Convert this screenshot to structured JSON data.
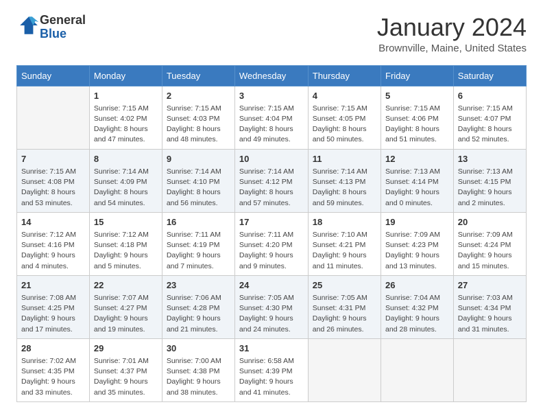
{
  "logo": {
    "text_general": "General",
    "text_blue": "Blue"
  },
  "header": {
    "month_title": "January 2024",
    "location": "Brownville, Maine, United States"
  },
  "weekdays": [
    "Sunday",
    "Monday",
    "Tuesday",
    "Wednesday",
    "Thursday",
    "Friday",
    "Saturday"
  ],
  "weeks": [
    [
      {
        "day": "",
        "empty": true
      },
      {
        "day": "1",
        "sunrise": "7:15 AM",
        "sunset": "4:02 PM",
        "daylight": "8 hours and 47 minutes."
      },
      {
        "day": "2",
        "sunrise": "7:15 AM",
        "sunset": "4:03 PM",
        "daylight": "8 hours and 48 minutes."
      },
      {
        "day": "3",
        "sunrise": "7:15 AM",
        "sunset": "4:04 PM",
        "daylight": "8 hours and 49 minutes."
      },
      {
        "day": "4",
        "sunrise": "7:15 AM",
        "sunset": "4:05 PM",
        "daylight": "8 hours and 50 minutes."
      },
      {
        "day": "5",
        "sunrise": "7:15 AM",
        "sunset": "4:06 PM",
        "daylight": "8 hours and 51 minutes."
      },
      {
        "day": "6",
        "sunrise": "7:15 AM",
        "sunset": "4:07 PM",
        "daylight": "8 hours and 52 minutes."
      }
    ],
    [
      {
        "day": "7",
        "sunrise": "7:15 AM",
        "sunset": "4:08 PM",
        "daylight": "8 hours and 53 minutes."
      },
      {
        "day": "8",
        "sunrise": "7:14 AM",
        "sunset": "4:09 PM",
        "daylight": "8 hours and 54 minutes."
      },
      {
        "day": "9",
        "sunrise": "7:14 AM",
        "sunset": "4:10 PM",
        "daylight": "8 hours and 56 minutes."
      },
      {
        "day": "10",
        "sunrise": "7:14 AM",
        "sunset": "4:12 PM",
        "daylight": "8 hours and 57 minutes."
      },
      {
        "day": "11",
        "sunrise": "7:14 AM",
        "sunset": "4:13 PM",
        "daylight": "8 hours and 59 minutes."
      },
      {
        "day": "12",
        "sunrise": "7:13 AM",
        "sunset": "4:14 PM",
        "daylight": "9 hours and 0 minutes."
      },
      {
        "day": "13",
        "sunrise": "7:13 AM",
        "sunset": "4:15 PM",
        "daylight": "9 hours and 2 minutes."
      }
    ],
    [
      {
        "day": "14",
        "sunrise": "7:12 AM",
        "sunset": "4:16 PM",
        "daylight": "9 hours and 4 minutes."
      },
      {
        "day": "15",
        "sunrise": "7:12 AM",
        "sunset": "4:18 PM",
        "daylight": "9 hours and 5 minutes."
      },
      {
        "day": "16",
        "sunrise": "7:11 AM",
        "sunset": "4:19 PM",
        "daylight": "9 hours and 7 minutes."
      },
      {
        "day": "17",
        "sunrise": "7:11 AM",
        "sunset": "4:20 PM",
        "daylight": "9 hours and 9 minutes."
      },
      {
        "day": "18",
        "sunrise": "7:10 AM",
        "sunset": "4:21 PM",
        "daylight": "9 hours and 11 minutes."
      },
      {
        "day": "19",
        "sunrise": "7:09 AM",
        "sunset": "4:23 PM",
        "daylight": "9 hours and 13 minutes."
      },
      {
        "day": "20",
        "sunrise": "7:09 AM",
        "sunset": "4:24 PM",
        "daylight": "9 hours and 15 minutes."
      }
    ],
    [
      {
        "day": "21",
        "sunrise": "7:08 AM",
        "sunset": "4:25 PM",
        "daylight": "9 hours and 17 minutes."
      },
      {
        "day": "22",
        "sunrise": "7:07 AM",
        "sunset": "4:27 PM",
        "daylight": "9 hours and 19 minutes."
      },
      {
        "day": "23",
        "sunrise": "7:06 AM",
        "sunset": "4:28 PM",
        "daylight": "9 hours and 21 minutes."
      },
      {
        "day": "24",
        "sunrise": "7:05 AM",
        "sunset": "4:30 PM",
        "daylight": "9 hours and 24 minutes."
      },
      {
        "day": "25",
        "sunrise": "7:05 AM",
        "sunset": "4:31 PM",
        "daylight": "9 hours and 26 minutes."
      },
      {
        "day": "26",
        "sunrise": "7:04 AM",
        "sunset": "4:32 PM",
        "daylight": "9 hours and 28 minutes."
      },
      {
        "day": "27",
        "sunrise": "7:03 AM",
        "sunset": "4:34 PM",
        "daylight": "9 hours and 31 minutes."
      }
    ],
    [
      {
        "day": "28",
        "sunrise": "7:02 AM",
        "sunset": "4:35 PM",
        "daylight": "9 hours and 33 minutes."
      },
      {
        "day": "29",
        "sunrise": "7:01 AM",
        "sunset": "4:37 PM",
        "daylight": "9 hours and 35 minutes."
      },
      {
        "day": "30",
        "sunrise": "7:00 AM",
        "sunset": "4:38 PM",
        "daylight": "9 hours and 38 minutes."
      },
      {
        "day": "31",
        "sunrise": "6:58 AM",
        "sunset": "4:39 PM",
        "daylight": "9 hours and 41 minutes."
      },
      {
        "day": "",
        "empty": true
      },
      {
        "day": "",
        "empty": true
      },
      {
        "day": "",
        "empty": true
      }
    ]
  ],
  "labels": {
    "sunrise_prefix": "Sunrise: ",
    "sunset_prefix": "Sunset: ",
    "daylight_prefix": "Daylight: "
  }
}
